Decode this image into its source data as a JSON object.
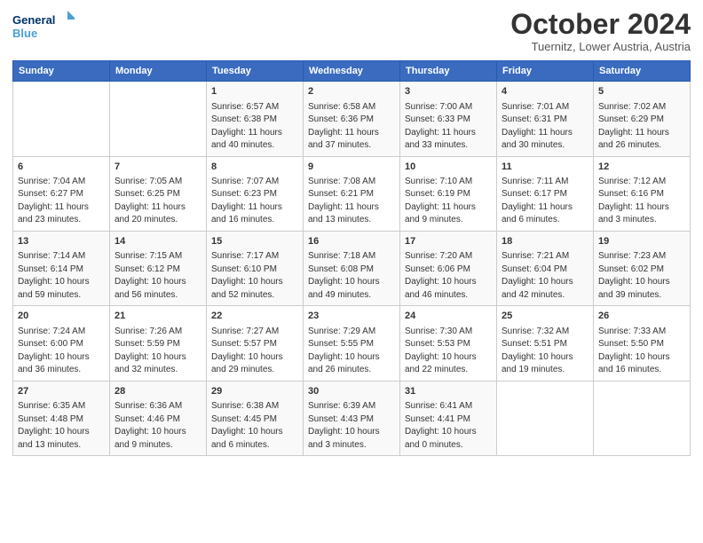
{
  "logo": {
    "line1": "General",
    "line2": "Blue"
  },
  "header": {
    "month": "October 2024",
    "location": "Tuernitz, Lower Austria, Austria"
  },
  "weekdays": [
    "Sunday",
    "Monday",
    "Tuesday",
    "Wednesday",
    "Thursday",
    "Friday",
    "Saturday"
  ],
  "weeks": [
    [
      {
        "day": "",
        "info": ""
      },
      {
        "day": "",
        "info": ""
      },
      {
        "day": "1",
        "info": "Sunrise: 6:57 AM\nSunset: 6:38 PM\nDaylight: 11 hours\nand 40 minutes."
      },
      {
        "day": "2",
        "info": "Sunrise: 6:58 AM\nSunset: 6:36 PM\nDaylight: 11 hours\nand 37 minutes."
      },
      {
        "day": "3",
        "info": "Sunrise: 7:00 AM\nSunset: 6:33 PM\nDaylight: 11 hours\nand 33 minutes."
      },
      {
        "day": "4",
        "info": "Sunrise: 7:01 AM\nSunset: 6:31 PM\nDaylight: 11 hours\nand 30 minutes."
      },
      {
        "day": "5",
        "info": "Sunrise: 7:02 AM\nSunset: 6:29 PM\nDaylight: 11 hours\nand 26 minutes."
      }
    ],
    [
      {
        "day": "6",
        "info": "Sunrise: 7:04 AM\nSunset: 6:27 PM\nDaylight: 11 hours\nand 23 minutes."
      },
      {
        "day": "7",
        "info": "Sunrise: 7:05 AM\nSunset: 6:25 PM\nDaylight: 11 hours\nand 20 minutes."
      },
      {
        "day": "8",
        "info": "Sunrise: 7:07 AM\nSunset: 6:23 PM\nDaylight: 11 hours\nand 16 minutes."
      },
      {
        "day": "9",
        "info": "Sunrise: 7:08 AM\nSunset: 6:21 PM\nDaylight: 11 hours\nand 13 minutes."
      },
      {
        "day": "10",
        "info": "Sunrise: 7:10 AM\nSunset: 6:19 PM\nDaylight: 11 hours\nand 9 minutes."
      },
      {
        "day": "11",
        "info": "Sunrise: 7:11 AM\nSunset: 6:17 PM\nDaylight: 11 hours\nand 6 minutes."
      },
      {
        "day": "12",
        "info": "Sunrise: 7:12 AM\nSunset: 6:16 PM\nDaylight: 11 hours\nand 3 minutes."
      }
    ],
    [
      {
        "day": "13",
        "info": "Sunrise: 7:14 AM\nSunset: 6:14 PM\nDaylight: 10 hours\nand 59 minutes."
      },
      {
        "day": "14",
        "info": "Sunrise: 7:15 AM\nSunset: 6:12 PM\nDaylight: 10 hours\nand 56 minutes."
      },
      {
        "day": "15",
        "info": "Sunrise: 7:17 AM\nSunset: 6:10 PM\nDaylight: 10 hours\nand 52 minutes."
      },
      {
        "day": "16",
        "info": "Sunrise: 7:18 AM\nSunset: 6:08 PM\nDaylight: 10 hours\nand 49 minutes."
      },
      {
        "day": "17",
        "info": "Sunrise: 7:20 AM\nSunset: 6:06 PM\nDaylight: 10 hours\nand 46 minutes."
      },
      {
        "day": "18",
        "info": "Sunrise: 7:21 AM\nSunset: 6:04 PM\nDaylight: 10 hours\nand 42 minutes."
      },
      {
        "day": "19",
        "info": "Sunrise: 7:23 AM\nSunset: 6:02 PM\nDaylight: 10 hours\nand 39 minutes."
      }
    ],
    [
      {
        "day": "20",
        "info": "Sunrise: 7:24 AM\nSunset: 6:00 PM\nDaylight: 10 hours\nand 36 minutes."
      },
      {
        "day": "21",
        "info": "Sunrise: 7:26 AM\nSunset: 5:59 PM\nDaylight: 10 hours\nand 32 minutes."
      },
      {
        "day": "22",
        "info": "Sunrise: 7:27 AM\nSunset: 5:57 PM\nDaylight: 10 hours\nand 29 minutes."
      },
      {
        "day": "23",
        "info": "Sunrise: 7:29 AM\nSunset: 5:55 PM\nDaylight: 10 hours\nand 26 minutes."
      },
      {
        "day": "24",
        "info": "Sunrise: 7:30 AM\nSunset: 5:53 PM\nDaylight: 10 hours\nand 22 minutes."
      },
      {
        "day": "25",
        "info": "Sunrise: 7:32 AM\nSunset: 5:51 PM\nDaylight: 10 hours\nand 19 minutes."
      },
      {
        "day": "26",
        "info": "Sunrise: 7:33 AM\nSunset: 5:50 PM\nDaylight: 10 hours\nand 16 minutes."
      }
    ],
    [
      {
        "day": "27",
        "info": "Sunrise: 6:35 AM\nSunset: 4:48 PM\nDaylight: 10 hours\nand 13 minutes."
      },
      {
        "day": "28",
        "info": "Sunrise: 6:36 AM\nSunset: 4:46 PM\nDaylight: 10 hours\nand 9 minutes."
      },
      {
        "day": "29",
        "info": "Sunrise: 6:38 AM\nSunset: 4:45 PM\nDaylight: 10 hours\nand 6 minutes."
      },
      {
        "day": "30",
        "info": "Sunrise: 6:39 AM\nSunset: 4:43 PM\nDaylight: 10 hours\nand 3 minutes."
      },
      {
        "day": "31",
        "info": "Sunrise: 6:41 AM\nSunset: 4:41 PM\nDaylight: 10 hours\nand 0 minutes."
      },
      {
        "day": "",
        "info": ""
      },
      {
        "day": "",
        "info": ""
      }
    ]
  ]
}
